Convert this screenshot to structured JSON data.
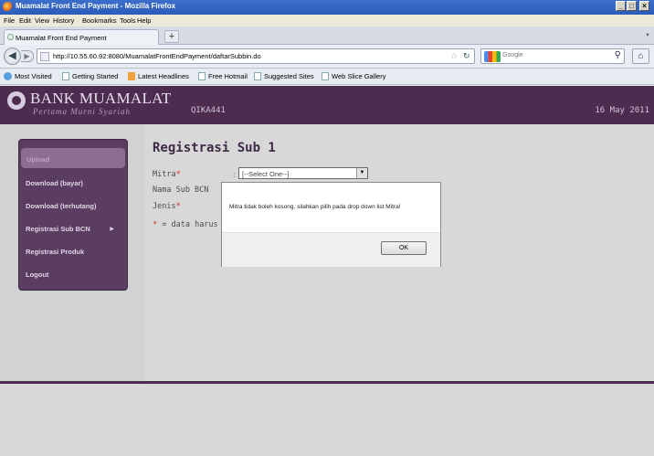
{
  "window": {
    "title": "Muamalat Front End Payment - Mozilla Firefox",
    "controls": [
      "_",
      "×"
    ]
  },
  "menu": [
    "File",
    "Edit",
    "View",
    "History",
    "Bookmarks",
    "Tools",
    "Help"
  ],
  "tab": {
    "label": "Muamalat Front End Payment",
    "new_tab": "+"
  },
  "nav": {
    "url": "http://10.55.60.92:8080/MuamalatFrontEndPayment/daftarSubbin.do",
    "search_placeholder": "Google"
  },
  "bookmarks": [
    "Most Visited",
    "Getting Started",
    "Latest Headlines",
    "Free Hotmail",
    "Suggested Sites",
    "Web Slice Gallery"
  ],
  "header": {
    "brand": "BANK MUAMALAT",
    "tagline": "Pertama Murni Syariah",
    "user_id": "QIKA441",
    "date": "16 May 2011"
  },
  "sidebar": {
    "items": [
      {
        "label": "Upload"
      },
      {
        "label": "Download (bayar)"
      },
      {
        "label": "Download (terhutang)"
      },
      {
        "label": "Registrasi Sub BCN",
        "has_submenu": true
      },
      {
        "label": "Registrasi Produk"
      },
      {
        "label": "Logout"
      }
    ]
  },
  "form": {
    "title": "Registrasi Sub 1",
    "mitra_label": "Mitra",
    "mitra_value": "[--Select One--]",
    "nama_label": "Nama Sub BCN",
    "jenis_label": "Jenis",
    "required_marker": "*",
    "required_note": "= data harus"
  },
  "dialog": {
    "message": "Mitra tidak boleh kosong, silahkan pilih pada drop down list Mitra!",
    "ok_label": "OK"
  }
}
